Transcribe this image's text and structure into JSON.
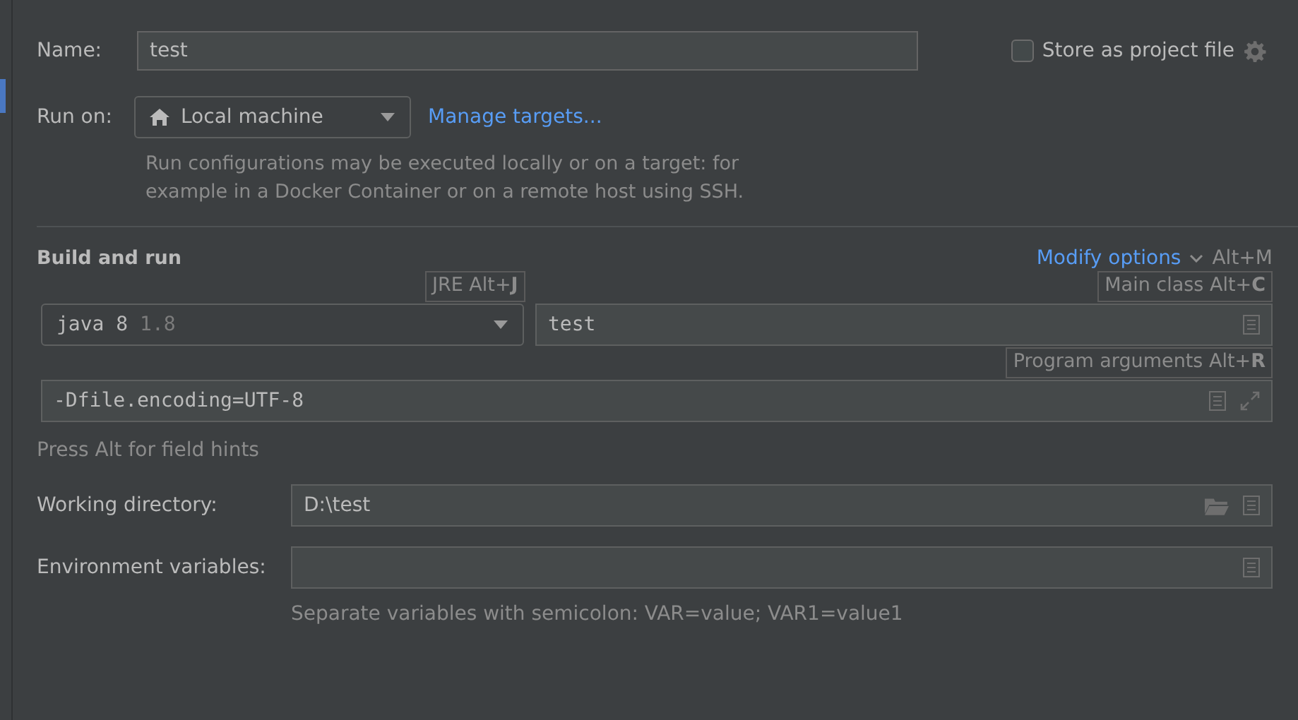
{
  "name_field": {
    "label": "Name:",
    "value": "test"
  },
  "store_as_project_file": {
    "label": "Store as project file",
    "checked": false
  },
  "run_on": {
    "label": "Run on:",
    "value": "Local machine",
    "link": "Manage targets...",
    "description_lines": [
      "Run configurations may be executed locally or on a target: for",
      "example in a Docker Container or on a remote host using SSH."
    ]
  },
  "build_and_run": {
    "title": "Build and run",
    "modify_options": "Modify options",
    "modify_shortcut": "Alt+M",
    "tooltips": [
      {
        "kind": "jre",
        "text": "JRE Alt+**J**"
      },
      {
        "kind": "main",
        "text": "Main class Alt+**C**"
      },
      {
        "kind": "args",
        "text": "Program arguments Alt+**R**"
      }
    ],
    "jre": {
      "value": "java 8",
      "version": "1.8"
    },
    "main_class": "test",
    "vm_options": "-Dfile.encoding=UTF-8",
    "note": "Press Alt for field hints"
  },
  "working_directory": {
    "label": "Working directory:",
    "value": "D:\\test"
  },
  "environment_variables": {
    "label": "Environment variables:",
    "description": "Separate variables with semicolon: VAR=value; VAR1=value1"
  }
}
